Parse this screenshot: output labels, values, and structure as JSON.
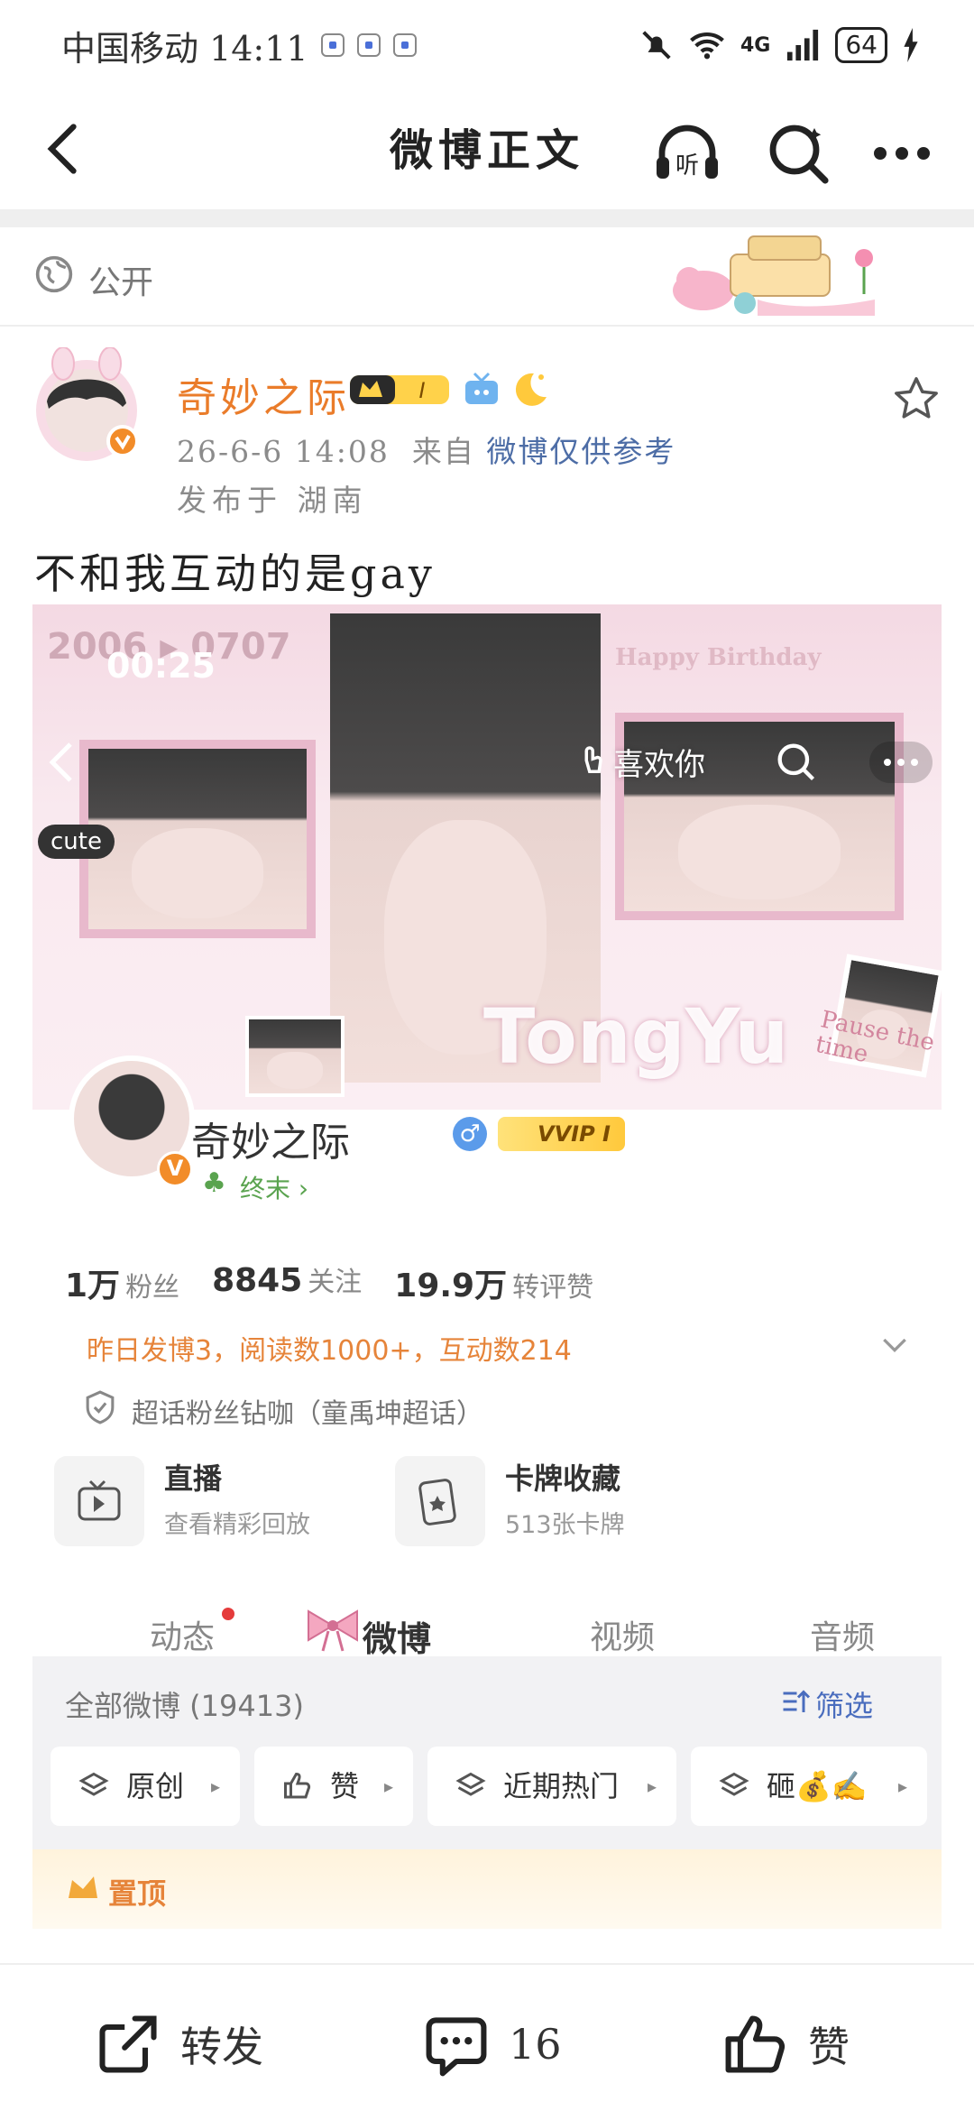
{
  "status_bar": {
    "carrier_time": "中国移动 14:11",
    "network": "4G",
    "battery": "64"
  },
  "nav": {
    "title": "微博正文",
    "listen_label": "听"
  },
  "visibility": {
    "label": "公开"
  },
  "post": {
    "author": "奇妙之际",
    "member_level": "I",
    "time": "26-6-6 14:08",
    "source_prefix": "来自",
    "source": "微博仅供参考",
    "location": "发布于 湖南",
    "text": "不和我互动的是gay"
  },
  "embedded": {
    "banner_year": "2006 ▸ 0707",
    "banner_clock": "00:25",
    "banner_bday": "Happy Birthday",
    "like_label": "喜欢你",
    "cute_tag": "cute",
    "overlay_name": "TongYu",
    "pause_text": "Pause the time",
    "profile_name": "奇妙之际",
    "gender": "♂",
    "vvip": "VVIP I",
    "tagline": "终末 ›",
    "stats": [
      {
        "num": "1万",
        "label": "粉丝"
      },
      {
        "num": "8845",
        "label": "关注"
      },
      {
        "num": "19.9万",
        "label": "转评赞"
      }
    ],
    "activity": "昨日发博3，阅读数1000+，互动数214",
    "chaohua": "超话粉丝钻咖（童禹坤超话）",
    "cards": [
      {
        "title": "直播",
        "sub": "查看精彩回放"
      },
      {
        "title": "卡牌收藏",
        "sub": "513张卡牌"
      }
    ],
    "tabs": [
      "动态",
      "微博",
      "视频",
      "音频"
    ],
    "filter_count": "全部微博 (19413)",
    "filter_label": "筛选",
    "chips": [
      {
        "label": "原创"
      },
      {
        "label": "赞"
      },
      {
        "label": "近期热门"
      },
      {
        "label": "砸💰✍️"
      }
    ],
    "pinned_label": "置顶"
  },
  "toolbar": {
    "repost": "转发",
    "comments": "16",
    "like": "赞"
  },
  "colors": {
    "author_orange": "#ea7c2a",
    "link_blue": "#4d6da6",
    "pink_theme": "#f4d9e3"
  }
}
